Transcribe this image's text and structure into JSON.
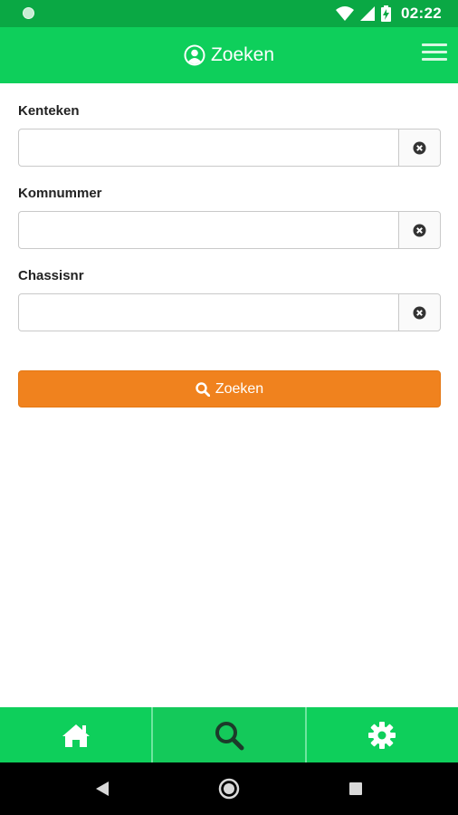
{
  "status_bar": {
    "time": "02:22",
    "icons": [
      "notification-dot-icon",
      "wifi-icon",
      "signal-icon",
      "battery-charging-icon"
    ]
  },
  "app_bar": {
    "title": "Zoeken",
    "title_icon": "user-circle-icon",
    "menu_icon": "hamburger-menu-icon"
  },
  "form": {
    "fields": [
      {
        "label": "Kenteken",
        "value": "",
        "clear_icon": "clear-x-icon"
      },
      {
        "label": "Komnummer",
        "value": "",
        "clear_icon": "clear-x-icon"
      },
      {
        "label": "Chassisnr",
        "value": "",
        "clear_icon": "clear-x-icon"
      }
    ],
    "submit": {
      "label": "Zoeken",
      "icon": "search-icon"
    }
  },
  "bottom_nav": {
    "items": [
      {
        "icon": "home-icon",
        "active": false
      },
      {
        "icon": "search-icon",
        "active": true
      },
      {
        "icon": "gear-icon",
        "active": false
      }
    ]
  },
  "system_nav": [
    "back-icon",
    "home-circle-icon",
    "recents-icon"
  ],
  "colors": {
    "app_bar": "#0ecf5b",
    "status_bar": "#0aa844",
    "button": "#f0821e",
    "nav_active_icon": "#1c3b2a"
  }
}
